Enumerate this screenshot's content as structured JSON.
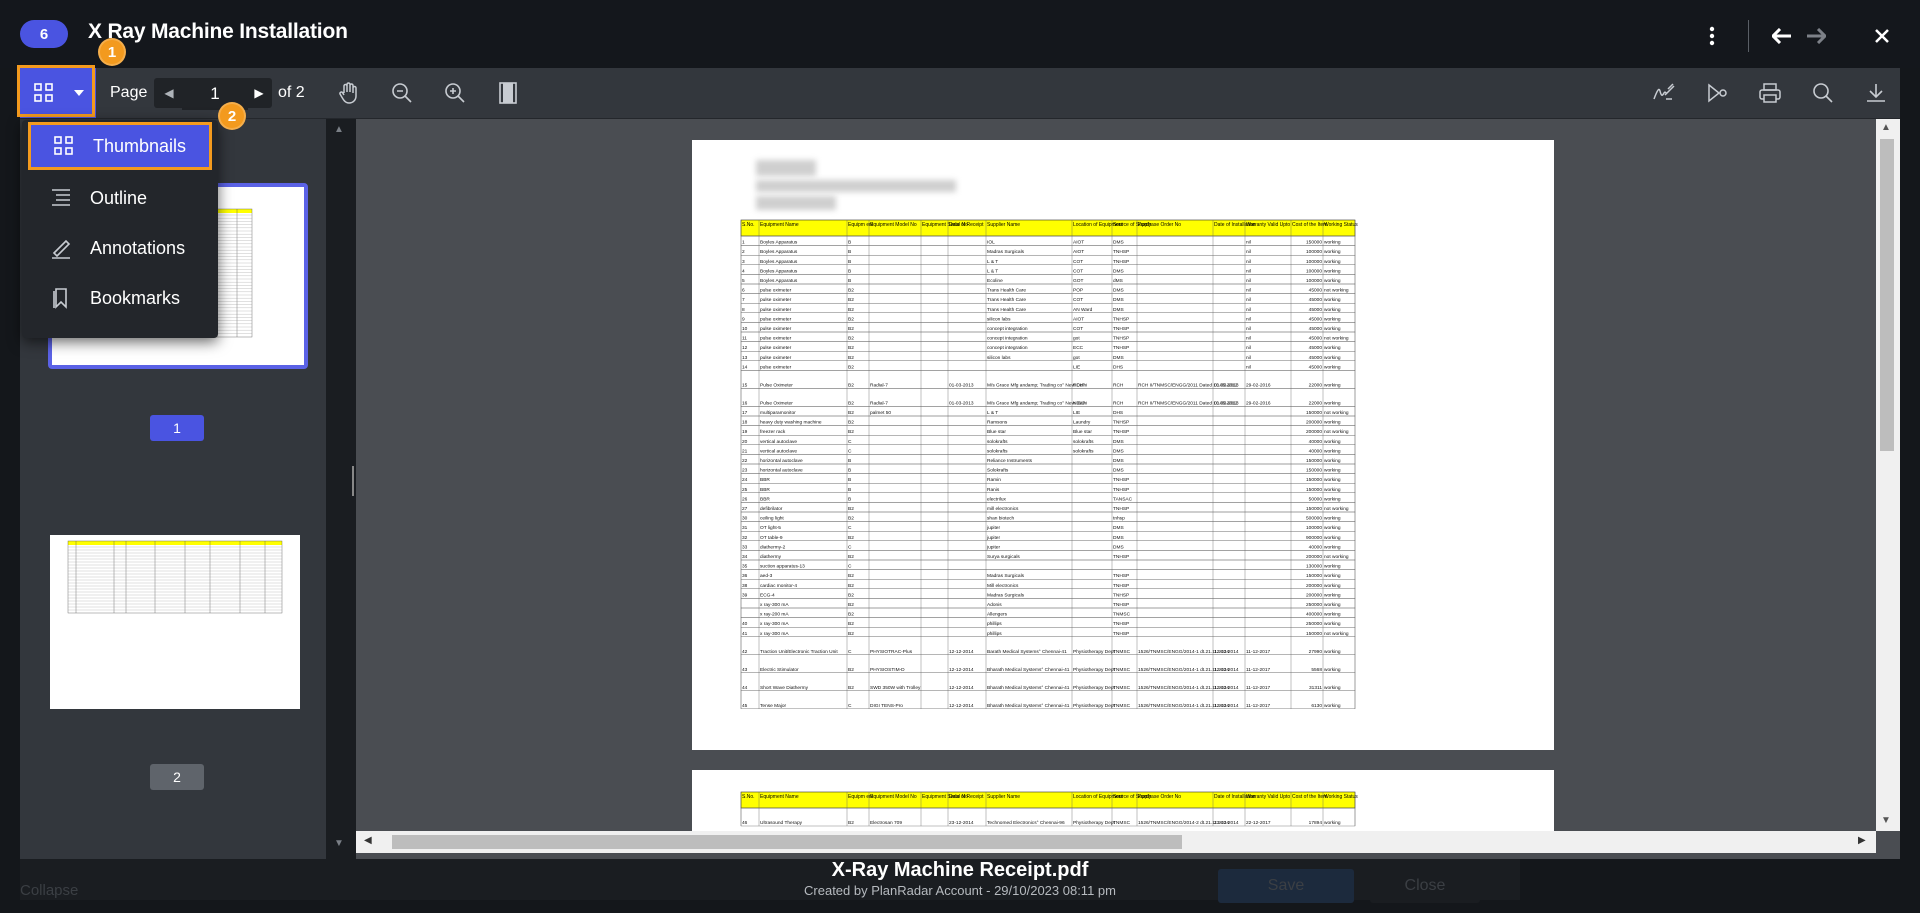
{
  "header": {
    "badge": "6",
    "title": "X Ray Machine Installation"
  },
  "toolbar": {
    "page_label": "Page",
    "page_value": "1",
    "page_total": "of 2"
  },
  "markers": [
    "1",
    "2"
  ],
  "view_menu": {
    "items": [
      {
        "label": "Thumbnails",
        "icon": "thumbnails-grid-icon",
        "active": true
      },
      {
        "label": "Outline",
        "icon": "outline-list-icon",
        "active": false
      },
      {
        "label": "Annotations",
        "icon": "pen-icon",
        "active": false
      },
      {
        "label": "Bookmarks",
        "icon": "bookmark-icon",
        "active": false
      }
    ]
  },
  "thumbnails": [
    {
      "page": "1",
      "selected": true
    },
    {
      "page": "2",
      "selected": false
    }
  ],
  "document": {
    "columns": [
      "S.No.",
      "Equipment Name",
      "Equipm ent",
      "Equipment Model No",
      "Equipment Serial No",
      "Date of Receipt",
      "Supplier Name",
      "Location of Equipment",
      "Source of Supply",
      "Purchase Order No",
      "Date of Installation",
      "Warranty Valid Upto",
      "Cost of the Item",
      "Working Status"
    ],
    "rows": [
      [
        "1",
        "Boyles Apparatus",
        "B",
        "",
        "",
        "",
        "IOL",
        "AIOT",
        "DMS",
        "",
        "",
        "nil",
        "150000",
        "working"
      ],
      [
        "2",
        "Boyles Apparatus",
        "B",
        "",
        "",
        "",
        "Madras Surgicals",
        "AIOT",
        "TNHSP",
        "",
        "",
        "nil",
        "100000",
        "working"
      ],
      [
        "3",
        "Boyles Apparatus",
        "B",
        "",
        "",
        "",
        "L & T",
        "COT",
        "TNHSP",
        "",
        "",
        "nil",
        "100000",
        "working"
      ],
      [
        "4",
        "Boyles Apparatus",
        "B",
        "",
        "",
        "",
        "L & T",
        "COT",
        "DMS",
        "",
        "",
        "nil",
        "100000",
        "working"
      ],
      [
        "5",
        "Boyles Apparatus",
        "B",
        "",
        "",
        "",
        "Ecoline",
        "GOT",
        "dMS",
        "",
        "",
        "nil",
        "100000",
        "working"
      ],
      [
        "6",
        "pulse oximeter",
        "B2",
        "",
        "",
        "",
        "Trans Health Care",
        "POP",
        "DMS",
        "",
        "",
        "nil",
        "45000",
        "not working"
      ],
      [
        "7",
        "pulse oximeter",
        "B2",
        "",
        "",
        "",
        "Trans Health Care",
        "COT",
        "DMS",
        "",
        "",
        "nil",
        "45000",
        "working"
      ],
      [
        "8",
        "pulse oximeter",
        "B2",
        "",
        "",
        "",
        "Trans Health Care",
        "AN Ward",
        "DMS",
        "",
        "",
        "nil",
        "45000",
        "working"
      ],
      [
        "9",
        "pulse oximeter",
        "B2",
        "",
        "",
        "",
        "silicon labs",
        "AIOT",
        "TNHSP",
        "",
        "",
        "nil",
        "45000",
        "working"
      ],
      [
        "10",
        "pulse oximeter",
        "B2",
        "",
        "",
        "",
        "concept integration",
        "COT",
        "TNHSP",
        "",
        "",
        "nil",
        "45000",
        "working"
      ],
      [
        "11",
        "pulse oximeter",
        "B2",
        "",
        "",
        "",
        "concept integration",
        "got",
        "TNHSP",
        "",
        "",
        "nil",
        "45000",
        "not working"
      ],
      [
        "12",
        "pulse oximeter",
        "B2",
        "",
        "",
        "",
        "concept integration",
        "ECC",
        "TNHSP",
        "",
        "",
        "nil",
        "45000",
        "working"
      ],
      [
        "13",
        "pulse oximeter",
        "B2",
        "",
        "",
        "",
        "silicon labs",
        "got",
        "DMS",
        "",
        "",
        "nil",
        "45000",
        "working"
      ],
      [
        "14",
        "pulse oximeter",
        "B2",
        "",
        "",
        "",
        "",
        "LIE",
        "DHS",
        "",
        "",
        "nil",
        "45000",
        "working"
      ],
      [
        "15",
        "Pulse Oximeter",
        "B2",
        "Radial-7",
        "",
        "01-03-2013",
        "M/s Grace Mfg andamp; Trading co° New Delhi",
        "RCH",
        "RCH",
        "RCH II/TNMSC/ENGG/2011 Dated 10.05.2012",
        "01-03-2013",
        "29-02-2016",
        "22000",
        "working"
      ],
      [
        "16",
        "Pulse Oximeter",
        "B2",
        "Radial-7",
        "",
        "01-03-2013",
        "M/s Grace Mfg andamp; Trading co° New Delhi",
        "NICU",
        "RCH",
        "RCH II/TNMSC/ENGG/2011 Dated 10.05.2012",
        "01-03-2013",
        "29-02-2016",
        "22000",
        "working"
      ],
      [
        "17",
        "multiparamonitor",
        "B2",
        "palmet 50",
        "",
        "",
        "L & T",
        "LIE",
        "DHS",
        "",
        "",
        "",
        "150000",
        "not working"
      ],
      [
        "18",
        "heavy duty washing machine",
        "B2",
        "",
        "",
        "",
        "Ramsons",
        "Laundry",
        "TNHSP",
        "",
        "",
        "",
        "200000",
        "working"
      ],
      [
        "19",
        "freezer rack",
        "B2",
        "",
        "",
        "",
        "Blue star",
        "Blue star",
        "TNHSP",
        "",
        "",
        "",
        "200000",
        "not working"
      ],
      [
        "20",
        "vertical autoclave",
        "C",
        "",
        "",
        "",
        "solokrafts",
        "solokrafts",
        "DMS",
        "",
        "",
        "",
        "40000",
        "working"
      ],
      [
        "21",
        "vertical autoclave",
        "C",
        "",
        "",
        "",
        "solokrafts",
        "solokrafts",
        "DMS",
        "",
        "",
        "",
        "40000",
        "working"
      ],
      [
        "22",
        "horizontal autoclave",
        "B",
        "",
        "",
        "",
        "Reliance Instruments",
        "",
        "DMS",
        "",
        "",
        "",
        "150000",
        "working"
      ],
      [
        "23",
        "horizontal autoclave",
        "B",
        "",
        "",
        "",
        "Solokrafts",
        "",
        "DMS",
        "",
        "",
        "",
        "150000",
        "working"
      ],
      [
        "24",
        "BBR",
        "B",
        "",
        "",
        "",
        "Ramin",
        "",
        "TNHSP",
        "",
        "",
        "",
        "150000",
        "working"
      ],
      [
        "25",
        "BBR",
        "B",
        "",
        "",
        "",
        "Ranis",
        "",
        "TNHSP",
        "",
        "",
        "",
        "150000",
        "working"
      ],
      [
        "26",
        "BBR",
        "B",
        "",
        "",
        "",
        "electrilux",
        "",
        "TANSAC",
        "",
        "",
        "",
        "50000",
        "working"
      ],
      [
        "27",
        "defibrilator",
        "B2",
        "",
        "",
        "",
        "mill electronics",
        "",
        "TNHSP",
        "",
        "",
        "",
        "150000",
        "not working"
      ],
      [
        "30",
        "ceiling light",
        "B2",
        "",
        "",
        "",
        "shan biotech",
        "",
        "tnhsp",
        "",
        "",
        "",
        "500000",
        "working"
      ],
      [
        "31",
        "OT light-5",
        "C",
        "",
        "",
        "",
        "jupiter",
        "",
        "DMS",
        "",
        "",
        "",
        "100000",
        "working"
      ],
      [
        "32",
        "OT table-9",
        "B2",
        "",
        "",
        "",
        "jupiter",
        "",
        "DMS",
        "",
        "",
        "",
        "900000",
        "working"
      ],
      [
        "33",
        "diathermy-2",
        "C",
        "",
        "",
        "",
        "jupiter",
        "",
        "DMS",
        "",
        "",
        "",
        "40000",
        "working"
      ],
      [
        "34",
        "diathermy",
        "B2",
        "",
        "",
        "",
        "Surya surgicals",
        "",
        "TNHSP",
        "",
        "",
        "",
        "200000",
        "not working"
      ],
      [
        "35",
        "suction apparatus-13",
        "C",
        "",
        "",
        "",
        "",
        "",
        "",
        "",
        "",
        "",
        "130000",
        "working"
      ],
      [
        "36",
        "aed-3",
        "B2",
        "",
        "",
        "",
        "Madras Surgicals",
        "",
        "TNHSP",
        "",
        "",
        "",
        "150000",
        "working"
      ],
      [
        "38",
        "cardiac monitor-4",
        "B2",
        "",
        "",
        "",
        "Mill electronics",
        "",
        "TNHSP",
        "",
        "",
        "",
        "200000",
        "working"
      ],
      [
        "39",
        "ECG-4",
        "B2",
        "",
        "",
        "",
        "Madras Surgicals",
        "",
        "TNHSP",
        "",
        "",
        "",
        "200000",
        "working"
      ],
      [
        "",
        "x ray-300 mA",
        "B2",
        "",
        "",
        "",
        "Adonis",
        "",
        "TNHSP",
        "",
        "",
        "",
        "250000",
        "working"
      ],
      [
        "",
        "x ray-200 mA",
        "B2",
        "",
        "",
        "",
        "Allengers",
        "",
        "TNMSC",
        "",
        "",
        "",
        "400000",
        "working"
      ],
      [
        "40",
        "x ray-300 mA",
        "B2",
        "",
        "",
        "",
        "phillips",
        "",
        "TNHSP",
        "",
        "",
        "",
        "250000",
        "working"
      ],
      [
        "41",
        "x ray-300 mA",
        "B2",
        "",
        "",
        "",
        "phillips",
        "",
        "TNHSP",
        "",
        "",
        "",
        "150000",
        "not working"
      ],
      [
        "42",
        "Traction Unit/Electronic Traction Unit",
        "C",
        "PHYSIOTRAC-Plus",
        "",
        "12-12-2014",
        "Barath Medical Systems° Chennai-41",
        "Physiotherapy Dept",
        "TNMSC",
        "1526/TNMSC/ENGG/2014-1 dt.21.11.2014",
        "12-12-2014",
        "11-12-2017",
        "27990",
        "working"
      ],
      [
        "43",
        "Electric Stimulator",
        "B2",
        "PHYSIOSTIM-D",
        "",
        "12-12-2014",
        "Bharath Medical Systems° Chennai-41",
        "Physiotherapy Dept",
        "TNMSC",
        "1526/TNMSC/ENGG/2014-1 dt.21.11.2014",
        "12-12-2014",
        "11-12-2017",
        "5568",
        "working"
      ],
      [
        "44",
        "Short Wave Diathermy",
        "B2",
        "SWD 350W with Trolley",
        "",
        "12-12-2014",
        "Bharath Medical Systems° Chennai-41",
        "Physiotherapy Dept",
        "TNMSC",
        "1526/TNMSC/ENGG/2014-1 dt.21.11.2014",
        "12-12-2014",
        "11-12-2017",
        "31311",
        "working"
      ],
      [
        "45",
        "Tense Major",
        "C",
        "DIGI TENS-Pro",
        "",
        "12-12-2014",
        "Bharath Medical Systems° Chennai-41",
        "Physiotherapy Dept",
        "TNMSC",
        "1526/TNMSC/ENGG/2014-1 dt.21.11.2014",
        "12-12-2014",
        "11-12-2017",
        "6130",
        "working"
      ]
    ],
    "page2_row": [
      "46",
      "Ultrasound Therapy",
      "B2",
      "Electrosan 709",
      "",
      "23-12-2014",
      "Technomed Electronics° Chennai-96",
      "Physiotherapy Dept",
      "TNMSC",
      "1526/TNMSC/ENGG/2014-2 dt.21.11.2014",
      "23-12-2014",
      "22-12-2017",
      "17894",
      "working"
    ]
  },
  "footer": {
    "filename": "X-Ray Machine Receipt.pdf",
    "meta": "Created by PlanRadar Account - 29/10/2023 08:11 pm"
  },
  "background": {
    "collapse": "Collapse",
    "save": "Save",
    "close": "Close"
  },
  "colors": {
    "accent": "#4a54e1",
    "highlight": "#f39a1e",
    "table_header": "#ffff00"
  }
}
